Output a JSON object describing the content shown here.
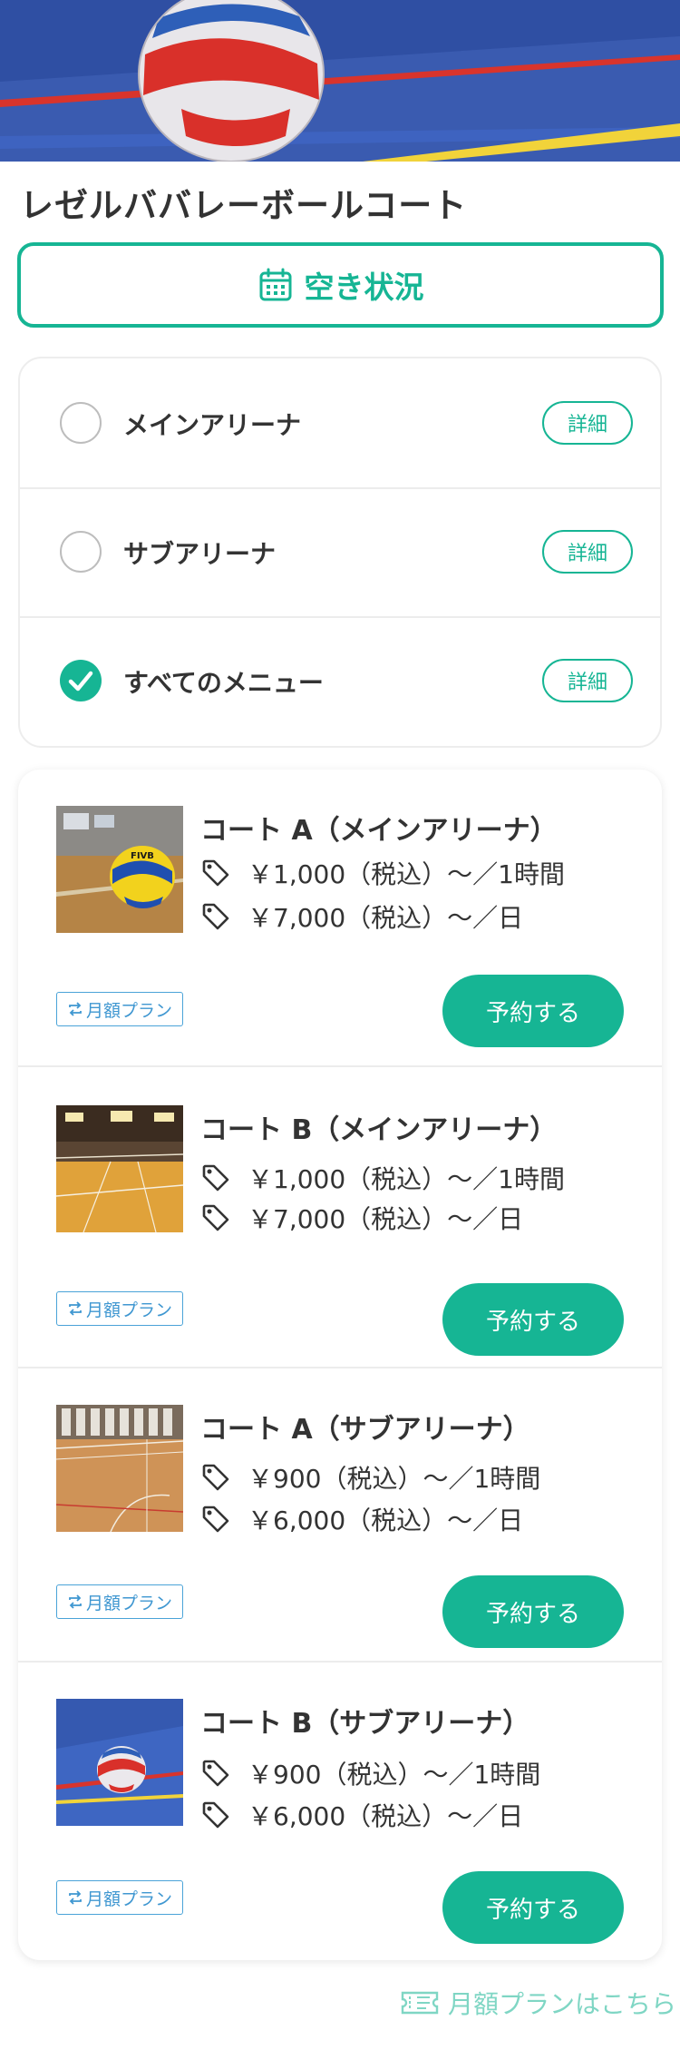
{
  "facility": {
    "name": "レゼルババレーボールコート"
  },
  "availability_button": {
    "label": "空き状況",
    "icon": "calendar-icon"
  },
  "filters": [
    {
      "label": "メインアリーナ",
      "checked": false,
      "detail_label": "詳細"
    },
    {
      "label": "サブアリーナ",
      "checked": false,
      "detail_label": "詳細"
    },
    {
      "label": "すべてのメニュー",
      "checked": true,
      "detail_label": "詳細"
    }
  ],
  "courts": [
    {
      "name": "コート A（メインアリーナ）",
      "prices": [
        "￥1,000（税込）〜／1時間",
        "￥7,000（税込）〜／日"
      ],
      "plan_badge": "月額プラン",
      "reserve_label": "予約する",
      "thumbnail": "volleyball-on-court-photo"
    },
    {
      "name": "コート B（メインアリーナ）",
      "prices": [
        "￥1,000（税込）〜／1時間",
        "￥7,000（税込）〜／日"
      ],
      "plan_badge": "月額プラン",
      "reserve_label": "予約する",
      "thumbnail": "gymnasium-net-photo"
    },
    {
      "name": "コート A（サブアリーナ）",
      "prices": [
        "￥900（税込）〜／1時間",
        "￥6,000（税込）〜／日"
      ],
      "plan_badge": "月額プラン",
      "reserve_label": "予約する",
      "thumbnail": "wooden-floor-net-photo"
    },
    {
      "name": "コート B（サブアリーナ）",
      "prices": [
        "￥900（税込）〜／1時間",
        "￥6,000（税込）〜／日"
      ],
      "plan_badge": "月額プラン",
      "reserve_label": "予約する",
      "thumbnail": "volleyball-blue-floor-photo"
    }
  ],
  "monthly_plan_link": {
    "label": "月額プランはこちら",
    "icon": "ticket-icon"
  },
  "colors": {
    "accent": "#16b594",
    "badge_blue": "#3f97d1",
    "text": "#333333",
    "link_light": "#7fd6c4"
  }
}
